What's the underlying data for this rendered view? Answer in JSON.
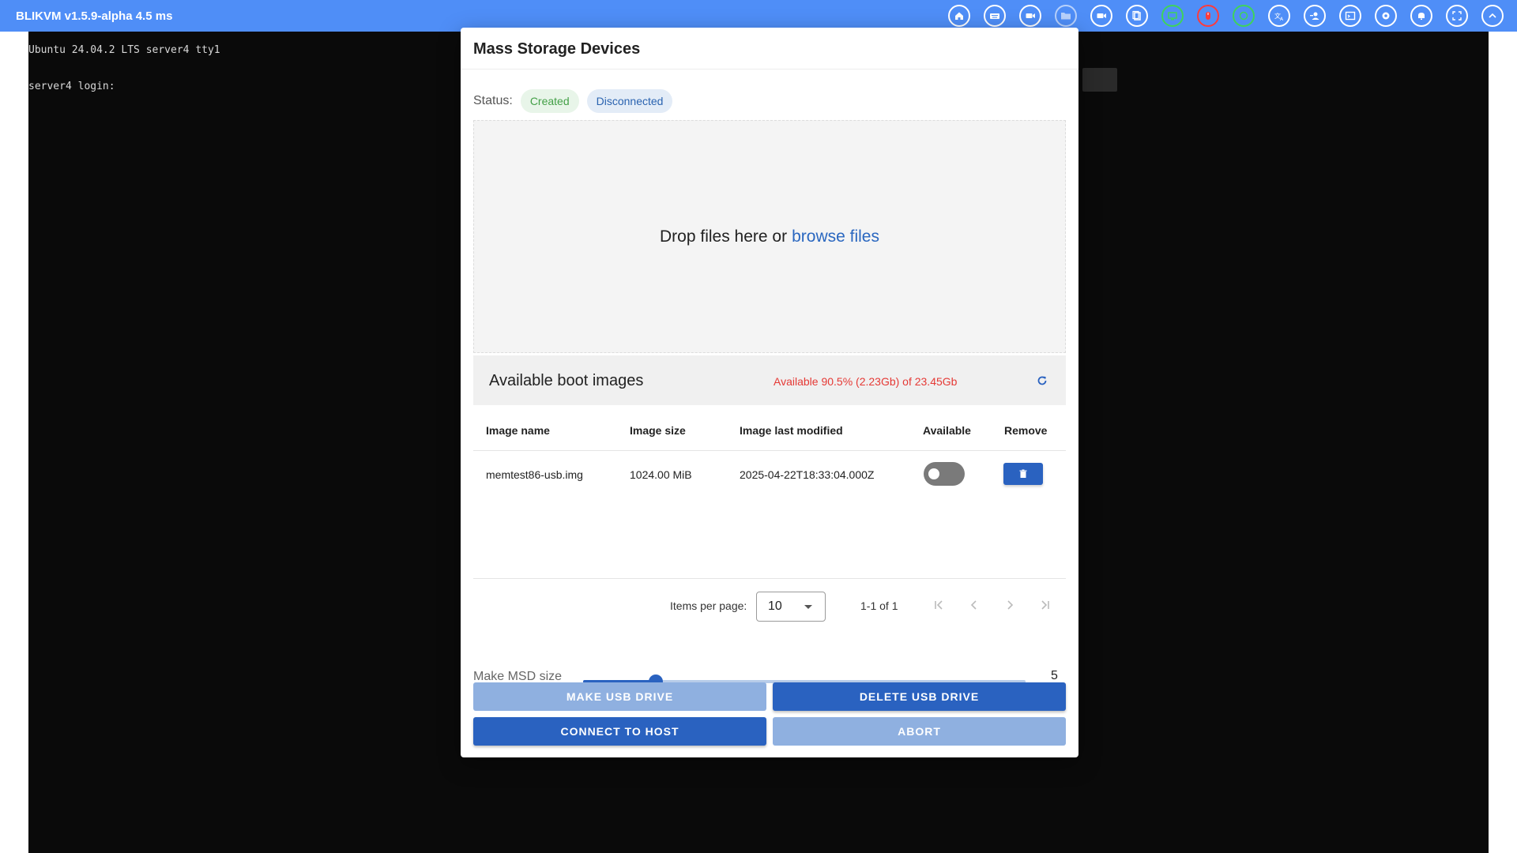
{
  "app": {
    "title": "BLIKVM v1.5.9-alpha 4.5 ms"
  },
  "toolbar_icons": [
    {
      "name": "home-icon",
      "color": "#ffffff"
    },
    {
      "name": "keyboard-icon",
      "color": "#ffffff"
    },
    {
      "name": "video-record-icon",
      "color": "#ffffff"
    },
    {
      "name": "folder-icon",
      "color": "#ffffff"
    },
    {
      "name": "camera-icon",
      "color": "#ffffff"
    },
    {
      "name": "copy-icon",
      "color": "#ffffff"
    },
    {
      "name": "monitor-status-icon",
      "color": "#3fd35a"
    },
    {
      "name": "mouse-icon",
      "color": "#ff3b3b"
    },
    {
      "name": "network-status-icon",
      "color": "#3fd35a"
    },
    {
      "name": "language-icon",
      "color": "#ffffff"
    },
    {
      "name": "users-icon",
      "color": "#ffffff"
    },
    {
      "name": "terminal-icon",
      "color": "#ffffff"
    },
    {
      "name": "settings-icon",
      "color": "#ffffff"
    },
    {
      "name": "notifications-icon",
      "color": "#ffffff"
    },
    {
      "name": "fullscreen-icon",
      "color": "#ffffff"
    },
    {
      "name": "collapse-icon",
      "color": "#ffffff"
    }
  ],
  "terminal": {
    "lines": [
      "Ubuntu 24.04.2 LTS server4 tty1",
      "server4 login:"
    ]
  },
  "dialog": {
    "title": "Mass Storage Devices",
    "status_label": "Status:",
    "status_created": "Created",
    "status_connection": "Disconnected",
    "dropzone_text": "Drop files here or",
    "dropzone_link": "browse files",
    "boot_title": "Available boot images",
    "boot_available": "Available 90.5% (2.23Gb) of 23.45Gb",
    "table": {
      "headers": [
        "Image name",
        "Image size",
        "Image last modified",
        "Available",
        "Remove"
      ],
      "rows": [
        {
          "name": "memtest86-usb.img",
          "size": "1024.00 MiB",
          "modified": "2025-04-22T18:33:04.000Z",
          "available": false
        }
      ]
    },
    "pagination": {
      "items_per_page_label": "Items per page:",
      "items_per_page": "10",
      "range": "1-1 of 1"
    },
    "msd": {
      "label": "Make MSD size",
      "value": "5",
      "slider_fraction": 0.165
    },
    "buttons": {
      "make": "MAKE USB DRIVE",
      "delete": "DELETE USB DRIVE",
      "connect": "CONNECT TO HOST",
      "abort": "ABORT"
    }
  },
  "colors": {
    "topbar": "#4f8ef7",
    "primary": "#2a62c0",
    "primary_disabled": "#8fb0e0",
    "available_text": "#e53935"
  }
}
